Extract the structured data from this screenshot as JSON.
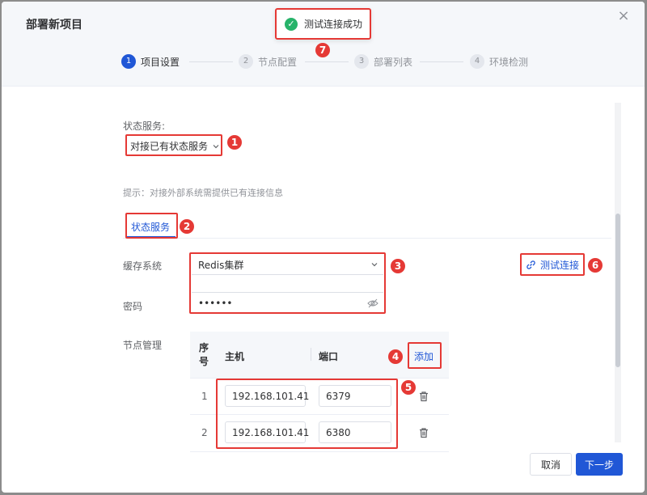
{
  "dialog": {
    "title": "部署新项目"
  },
  "toast": {
    "message": "测试连接成功"
  },
  "steps": [
    {
      "num": "1",
      "label": "项目设置"
    },
    {
      "num": "2",
      "label": "节点配置"
    },
    {
      "num": "3",
      "label": "部署列表"
    },
    {
      "num": "4",
      "label": "环境检测"
    }
  ],
  "form": {
    "state_service_label": "状态服务:",
    "state_service_value": "对接已有状态服务",
    "hint": "提示：对接外部系统需提供已有连接信息",
    "tab_label": "状态服务",
    "cache_label": "缓存系统",
    "cache_value": "Redis集群",
    "password_label": "密码",
    "password_value": "••••••",
    "test_connection": "测试连接",
    "node_label": "节点管理"
  },
  "table": {
    "headers": {
      "index": "序号",
      "host": "主机",
      "port": "端口",
      "add": "添加"
    },
    "rows": [
      {
        "index": "1",
        "host": "192.168.101.41",
        "port": "6379"
      },
      {
        "index": "2",
        "host": "192.168.101.41",
        "port": "6380"
      }
    ]
  },
  "footer": {
    "cancel": "取消",
    "next": "下一步"
  },
  "annotations": [
    "1",
    "2",
    "3",
    "4",
    "5",
    "6",
    "7"
  ],
  "colors": {
    "primary": "#2057d6",
    "annotation": "#e53935",
    "success": "#27b36a"
  }
}
